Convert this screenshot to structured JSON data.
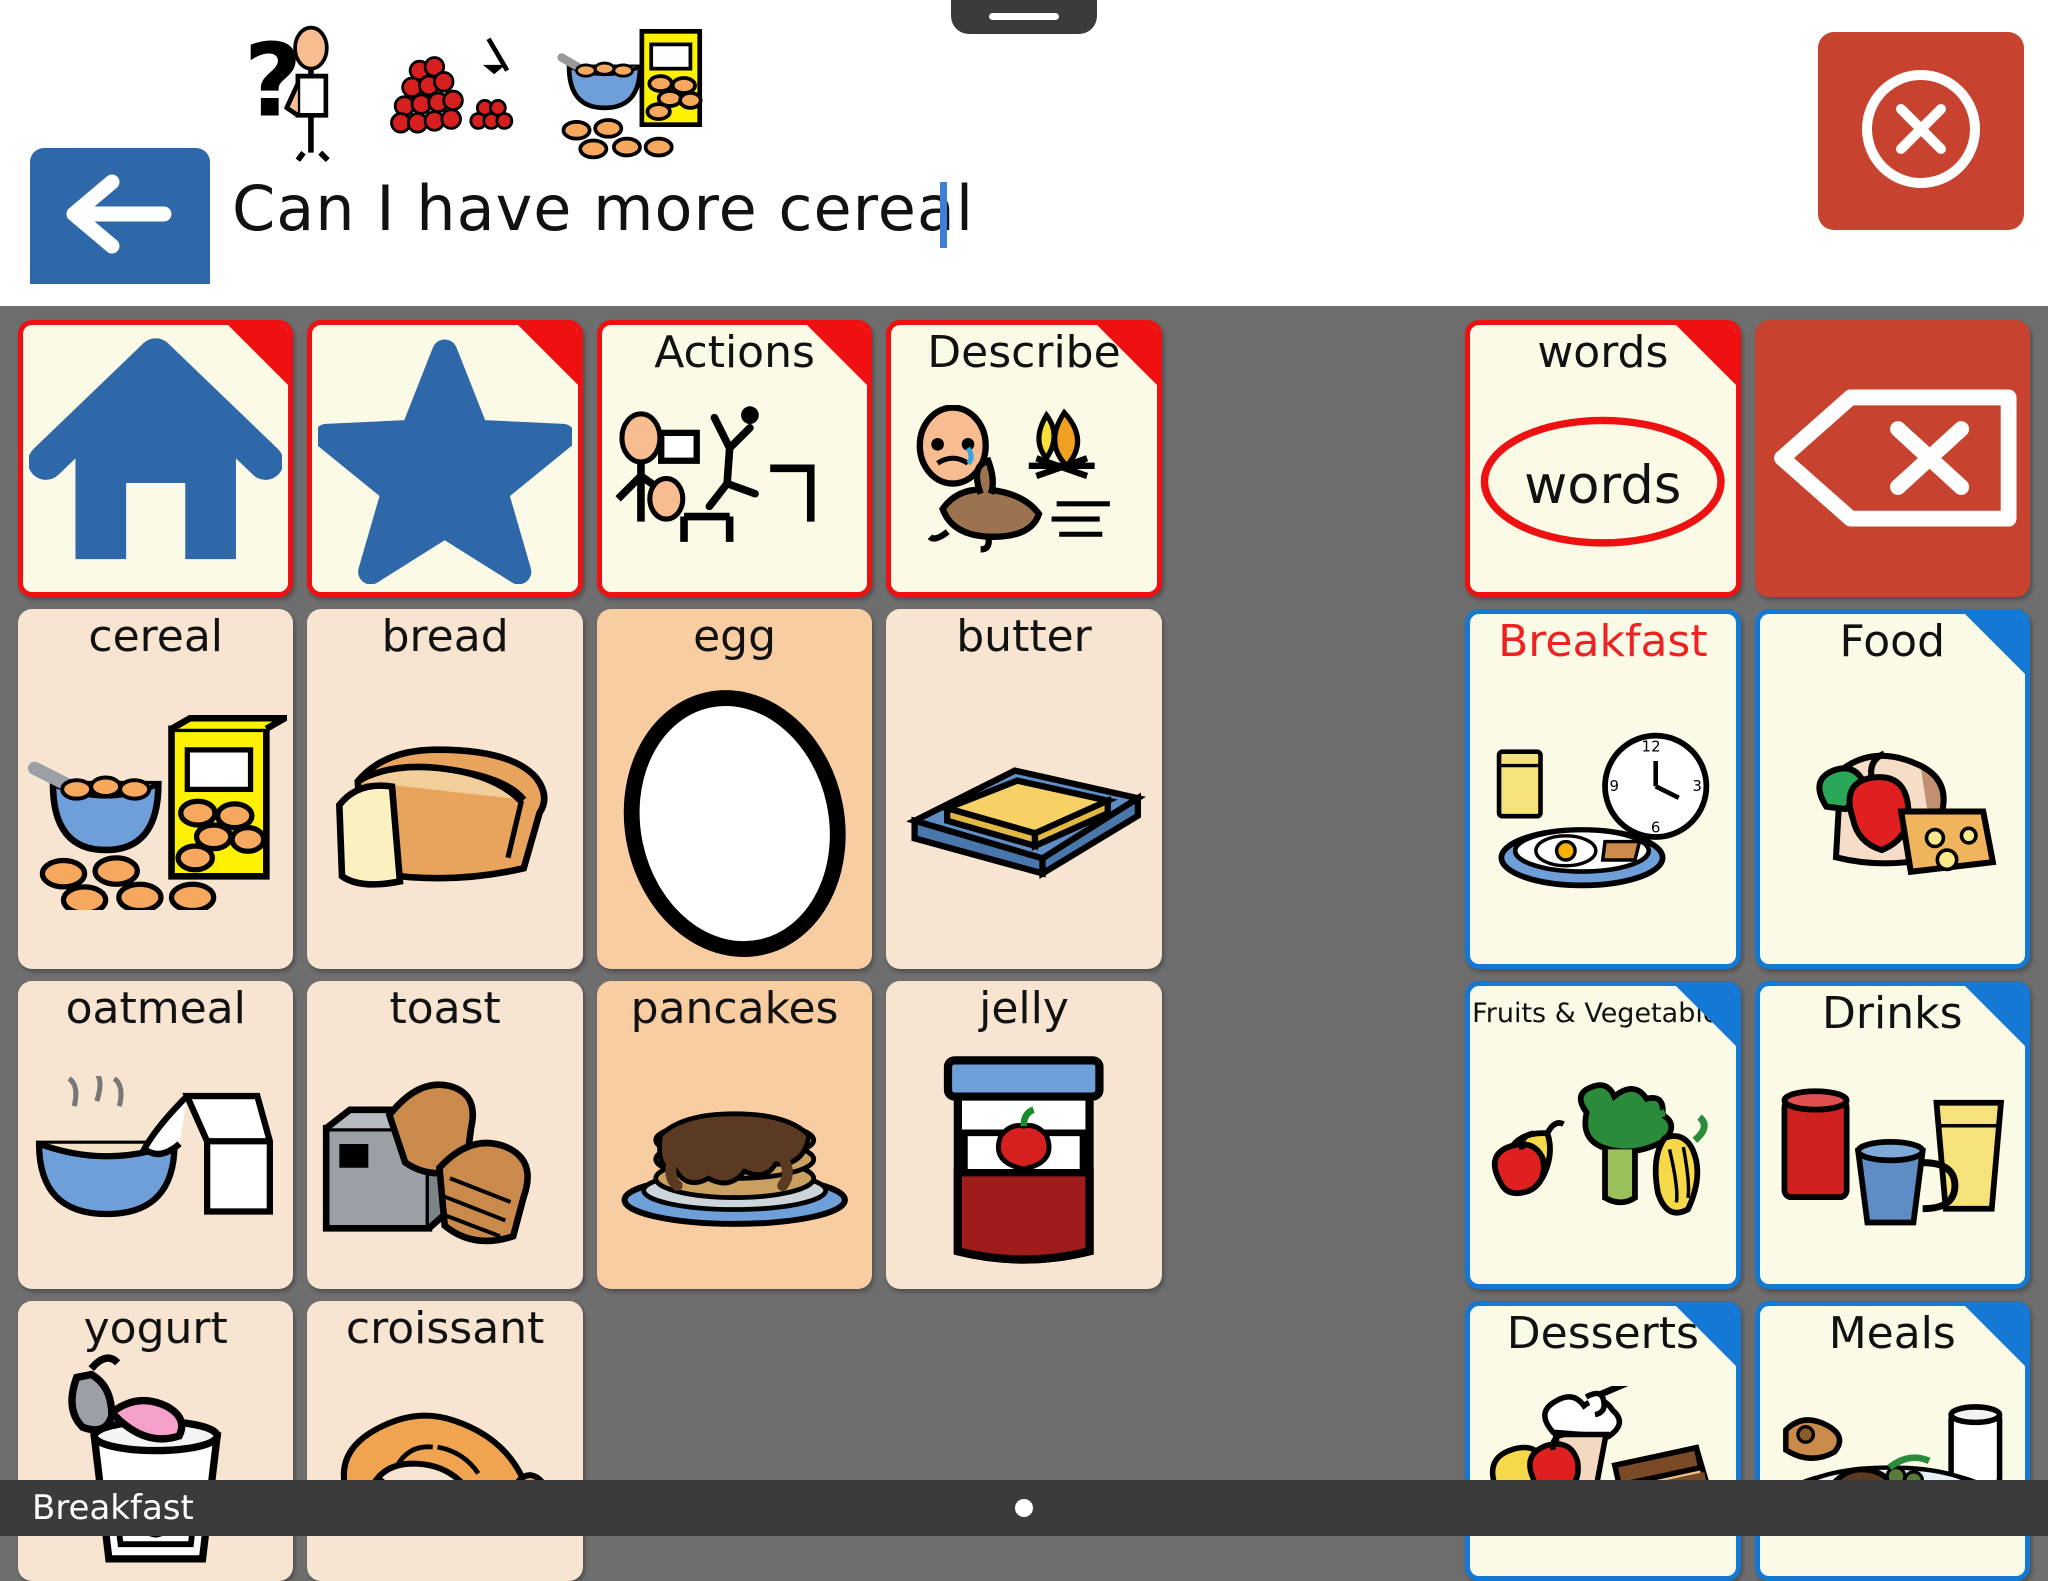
{
  "app": {
    "status_bar_title": "Breakfast",
    "page_indicator": "●"
  },
  "sentence_bar": {
    "text": "Can I have  more  cereal",
    "cursor_visible": true,
    "back_button_label": "back-arrow",
    "close_button_label": "close",
    "symbols": [
      "question-person",
      "more-berries",
      "cereal-bowl-box"
    ]
  },
  "colors": {
    "nav_border": "#ef1111",
    "category_border": "#1479d4",
    "nav_background": "#fbfae6",
    "word_background": "#f7e5d2",
    "word_highlight_background": "#f9cda2",
    "accent_blue": "#2e68a8",
    "accent_red": "#c8432f",
    "grid_background": "#6e6e6e",
    "status_bar_background": "#3b3b3b",
    "breakfast_label": "#ee2222"
  },
  "grid": {
    "rows": 5,
    "columns": 7,
    "buttons": [
      {
        "id": "home",
        "label": "",
        "type": "nav",
        "corner": "red",
        "icon": "home-icon"
      },
      {
        "id": "favorites",
        "label": "",
        "type": "nav",
        "corner": "red",
        "icon": "star-icon"
      },
      {
        "id": "actions",
        "label": "Actions",
        "type": "nav",
        "corner": "red",
        "icon": "actions-symbol"
      },
      {
        "id": "describe",
        "label": "Describe",
        "type": "nav",
        "corner": "red",
        "icon": "describe-symbol"
      },
      {
        "id": "words",
        "label": "words",
        "type": "nav",
        "corner": "red",
        "icon": "words-oval"
      },
      {
        "id": "delete",
        "label": "",
        "type": "plain-red",
        "corner": "none",
        "icon": "backspace-icon"
      },
      {
        "id": "cereal",
        "label": "cereal",
        "type": "word",
        "corner": "none",
        "icon": "cereal-symbol"
      },
      {
        "id": "bread",
        "label": "bread",
        "type": "word",
        "corner": "none",
        "icon": "bread-symbol"
      },
      {
        "id": "egg",
        "label": "egg",
        "type": "word",
        "corner": "none",
        "icon": "egg-symbol",
        "highlight": true
      },
      {
        "id": "butter",
        "label": "butter",
        "type": "word",
        "corner": "none",
        "icon": "butter-symbol"
      },
      {
        "id": "breakfast",
        "label": "Breakfast",
        "type": "cat",
        "corner": "none",
        "icon": "breakfast-symbol",
        "label_color": "red"
      },
      {
        "id": "food",
        "label": "Food",
        "type": "cat",
        "corner": "blue",
        "icon": "food-symbol"
      },
      {
        "id": "oatmeal",
        "label": "oatmeal",
        "type": "word",
        "corner": "none",
        "icon": "oatmeal-symbol"
      },
      {
        "id": "toast",
        "label": "toast",
        "type": "word",
        "corner": "none",
        "icon": "toast-symbol"
      },
      {
        "id": "pancakes",
        "label": "pancakes",
        "type": "word",
        "corner": "none",
        "icon": "pancakes-symbol",
        "highlight": true
      },
      {
        "id": "jelly",
        "label": "jelly",
        "type": "word",
        "corner": "none",
        "icon": "jelly-symbol"
      },
      {
        "id": "fruitsveg",
        "label": "Fruits & Vegetables",
        "type": "cat",
        "corner": "blue",
        "icon": "fruits-vegetables-symbol",
        "small_label": true
      },
      {
        "id": "drinks",
        "label": "Drinks",
        "type": "cat",
        "corner": "blue",
        "icon": "drinks-symbol"
      },
      {
        "id": "yogurt",
        "label": "yogurt",
        "type": "word",
        "corner": "none",
        "icon": "yogurt-symbol"
      },
      {
        "id": "croissant",
        "label": "croissant",
        "type": "word",
        "corner": "none",
        "icon": "croissant-symbol"
      },
      {
        "id": "desserts",
        "label": "Desserts",
        "type": "cat",
        "corner": "blue",
        "icon": "desserts-symbol"
      },
      {
        "id": "meals",
        "label": "Meals",
        "type": "cat",
        "corner": "blue",
        "icon": "meals-symbol"
      }
    ]
  }
}
